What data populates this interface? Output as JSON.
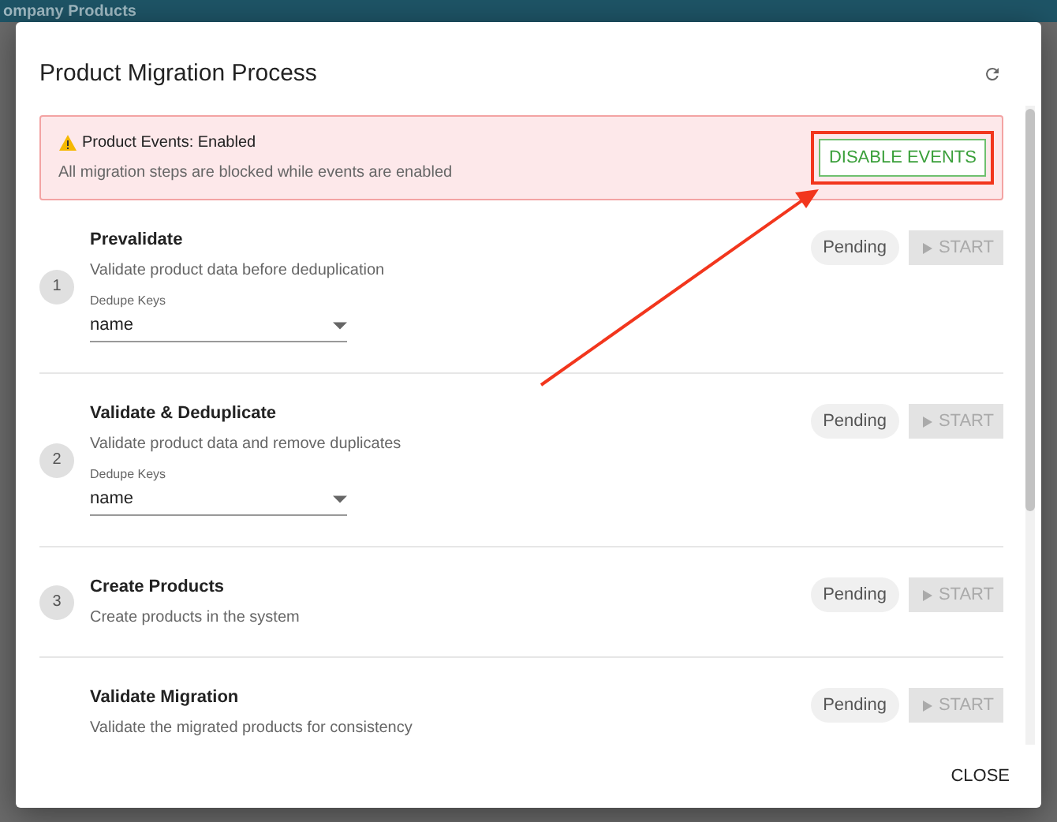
{
  "background_page": {
    "title": "ompany Products"
  },
  "dialog": {
    "title": "Product Migration Process",
    "alert": {
      "title": "Product Events: Enabled",
      "message": "All migration steps are blocked while events are enabled",
      "button": "DISABLE EVENTS",
      "highlighted": true
    },
    "steps": [
      {
        "number": "1",
        "title": "Prevalidate",
        "description": "Validate product data before deduplication",
        "field": {
          "label": "Dedupe Keys",
          "value": "name"
        },
        "status": "Pending",
        "button": "START",
        "disabled": true
      },
      {
        "number": "2",
        "title": "Validate & Deduplicate",
        "description": "Validate product data and remove duplicates",
        "field": {
          "label": "Dedupe Keys",
          "value": "name"
        },
        "status": "Pending",
        "button": "START",
        "disabled": true
      },
      {
        "number": "3",
        "title": "Create Products",
        "description": "Create products in the system",
        "status": "Pending",
        "button": "START",
        "disabled": true
      },
      {
        "title": "Validate Migration",
        "description": "Validate the migrated products for consistency",
        "status": "Pending",
        "button": "START",
        "disabled": true
      }
    ],
    "close_button": "CLOSE"
  }
}
